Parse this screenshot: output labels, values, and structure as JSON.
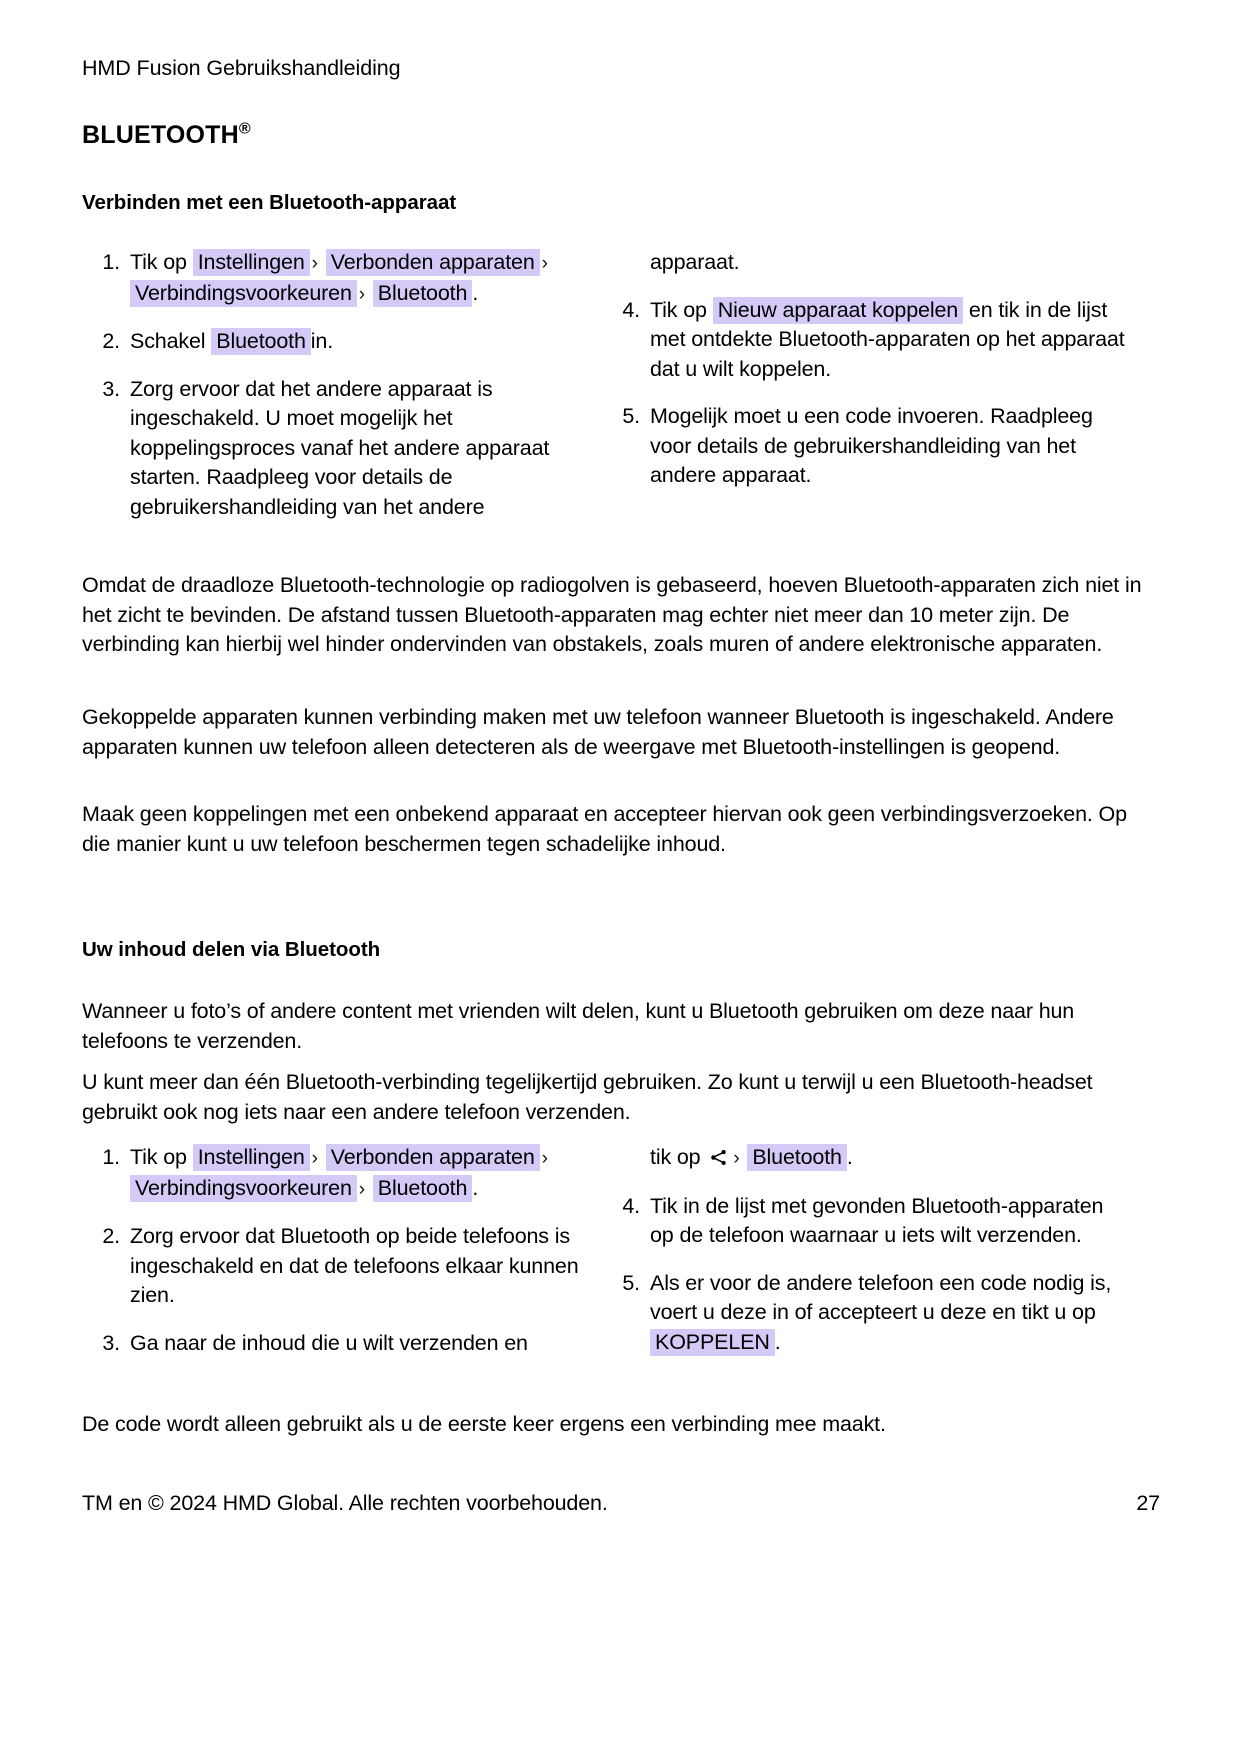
{
  "document": {
    "running_head": "HMD Fusion Gebruikshandleiding",
    "section_title": "BLUETOOTH",
    "section_title_symbol": "®"
  },
  "section_one": {
    "heading": "Verbinden met een Bluetooth-apparaat",
    "steps_left": [
      {
        "number": "1.",
        "prefix": "Tik op",
        "ui_terms": [
          "Instellingen",
          "Verbonden apparaten",
          "Verbindingsvoorkeuren",
          "Bluetooth"
        ],
        "separator": "›",
        "suffix": "."
      },
      {
        "number": "2.",
        "prefix": "Schakel",
        "ui_terms": [
          "Bluetooth"
        ],
        "suffix": "in."
      },
      {
        "number": "3.",
        "text": "Zorg ervoor dat het andere apparaat is ingeschakeld. U moet mogelijk het koppelingsproces vanaf het andere apparaat starten. Raadpleeg voor details de gebruikershandleiding van het andere"
      }
    ],
    "carry_right": "apparaat.",
    "steps_right": [
      {
        "number": "4.",
        "prefix": "Tik op",
        "ui_terms": [
          "Nieuw apparaat koppelen"
        ],
        "suffix": "en tik in de lijst met ontdekte Bluetooth-apparaten op het apparaat dat u wilt koppelen."
      },
      {
        "number": "5.",
        "text": "Mogelijk moet u een code invoeren. Raadpleeg voor details de gebruikershandleiding van het andere apparaat."
      }
    ]
  },
  "paragraphs": {
    "p1": "Omdat de draadloze Bluetooth-technologie op radiogolven is gebaseerd, hoeven Bluetooth-apparaten zich niet in het zicht te bevinden. De afstand tussen Bluetooth-apparaten mag echter niet meer dan 10 meter zijn. De verbinding kan hierbij wel hinder ondervinden van obstakels, zoals muren of andere elektronische apparaten.",
    "p2": "Gekoppelde apparaten kunnen verbinding maken met uw telefoon wanneer Bluetooth is ingeschakeld. Andere apparaten kunnen uw telefoon alleen detecteren als de weergave met Bluetooth-instellingen is geopend.",
    "p3": "Maak geen koppelingen met een onbekend apparaat en accepteer hiervan ook geen verbindingsverzoeken. Op die manier kunt u uw telefoon beschermen tegen schadelijke inhoud.",
    "p4": "Wanneer u foto’s of andere content met vrienden wilt delen, kunt u Bluetooth gebruiken om deze naar hun telefoons te verzenden.",
    "p5": "U kunt meer dan één Bluetooth-verbinding tegelijkertijd gebruiken. Zo kunt u terwijl u een Bluetooth-headset gebruikt ook nog iets naar een andere telefoon verzenden.",
    "p6": "De code wordt alleen gebruikt als u de eerste keer ergens een verbinding mee maakt."
  },
  "section_two": {
    "heading": "Uw inhoud delen via Bluetooth",
    "steps_left": [
      {
        "number": "1.",
        "prefix": "Tik op",
        "ui_terms": [
          "Instellingen",
          "Verbonden apparaten",
          "Verbindingsvoorkeuren",
          "Bluetooth"
        ],
        "separator": "›",
        "suffix": "."
      },
      {
        "number": "2.",
        "text": "Zorg ervoor dat Bluetooth op beide telefoons is ingeschakeld en dat de telefoons elkaar kunnen zien."
      },
      {
        "number": "3.",
        "text": "Ga naar de inhoud die u wilt verzenden en"
      }
    ],
    "carry_right": {
      "prefix": "tik op",
      "icon": "share-icon",
      "separator": "›",
      "ui_terms": [
        "Bluetooth"
      ],
      "suffix": "."
    },
    "steps_right": [
      {
        "number": "4.",
        "text": "Tik in de lijst met gevonden Bluetooth-apparaten op de telefoon waarnaar u iets wilt verzenden."
      },
      {
        "number": "5.",
        "prefix": "Als er voor de andere telefoon een code nodig is, voert u deze in of accepteert u deze en tikt u op",
        "ui_terms": [
          "KOPPELEN"
        ],
        "suffix": "."
      }
    ]
  },
  "footer": {
    "copyright": "TM en © 2024 HMD Global. Alle rechten voorbehouden.",
    "page_number": "27"
  },
  "colors": {
    "highlight": "#d5caf7",
    "text": "#000000",
    "background": "#ffffff"
  }
}
